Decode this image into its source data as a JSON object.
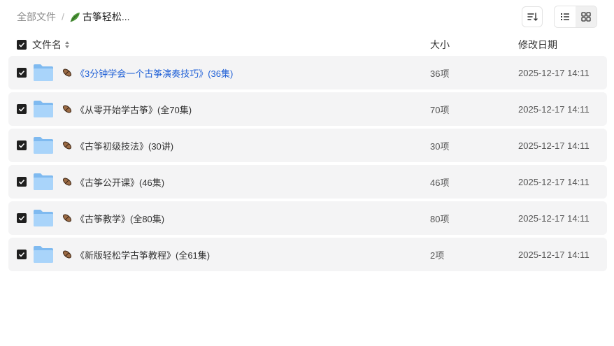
{
  "breadcrumb": {
    "root": "全部文件",
    "separator": "/",
    "current": "古筝轻松..."
  },
  "toolbar": {
    "sort_icon": "sort-icon",
    "list_view_icon": "list-view-icon",
    "grid_view_icon": "grid-view-icon",
    "active_view": "list"
  },
  "table": {
    "headers": {
      "name": "文件名",
      "size": "大小",
      "modified": "修改日期"
    },
    "rows": [
      {
        "name": "《3分钟学会一个古筝演奏技巧》(36集)",
        "size": "36项",
        "modified": "2025-12-17 14:11",
        "highlight": true
      },
      {
        "name": "《从零开始学古筝》(全70集)",
        "size": "70项",
        "modified": "2025-12-17 14:11",
        "highlight": false
      },
      {
        "name": "《古筝初级技法》(30讲)",
        "size": "30项",
        "modified": "2025-12-17 14:11",
        "highlight": false
      },
      {
        "name": "《古筝公开课》(46集)",
        "size": "46项",
        "modified": "2025-12-17 14:11",
        "highlight": false
      },
      {
        "name": "《古筝教学》(全80集)",
        "size": "80项",
        "modified": "2025-12-17 14:11",
        "highlight": false
      },
      {
        "name": "《新版轻松学古筝教程》(全61集)",
        "size": "2项",
        "modified": "2025-12-17 14:11",
        "highlight": false
      }
    ]
  },
  "colors": {
    "highlight_link": "#1e5fd6",
    "row_background": "#f4f4f5",
    "checkbox": "#1f1f1f",
    "folder": "#8cc4f5"
  }
}
